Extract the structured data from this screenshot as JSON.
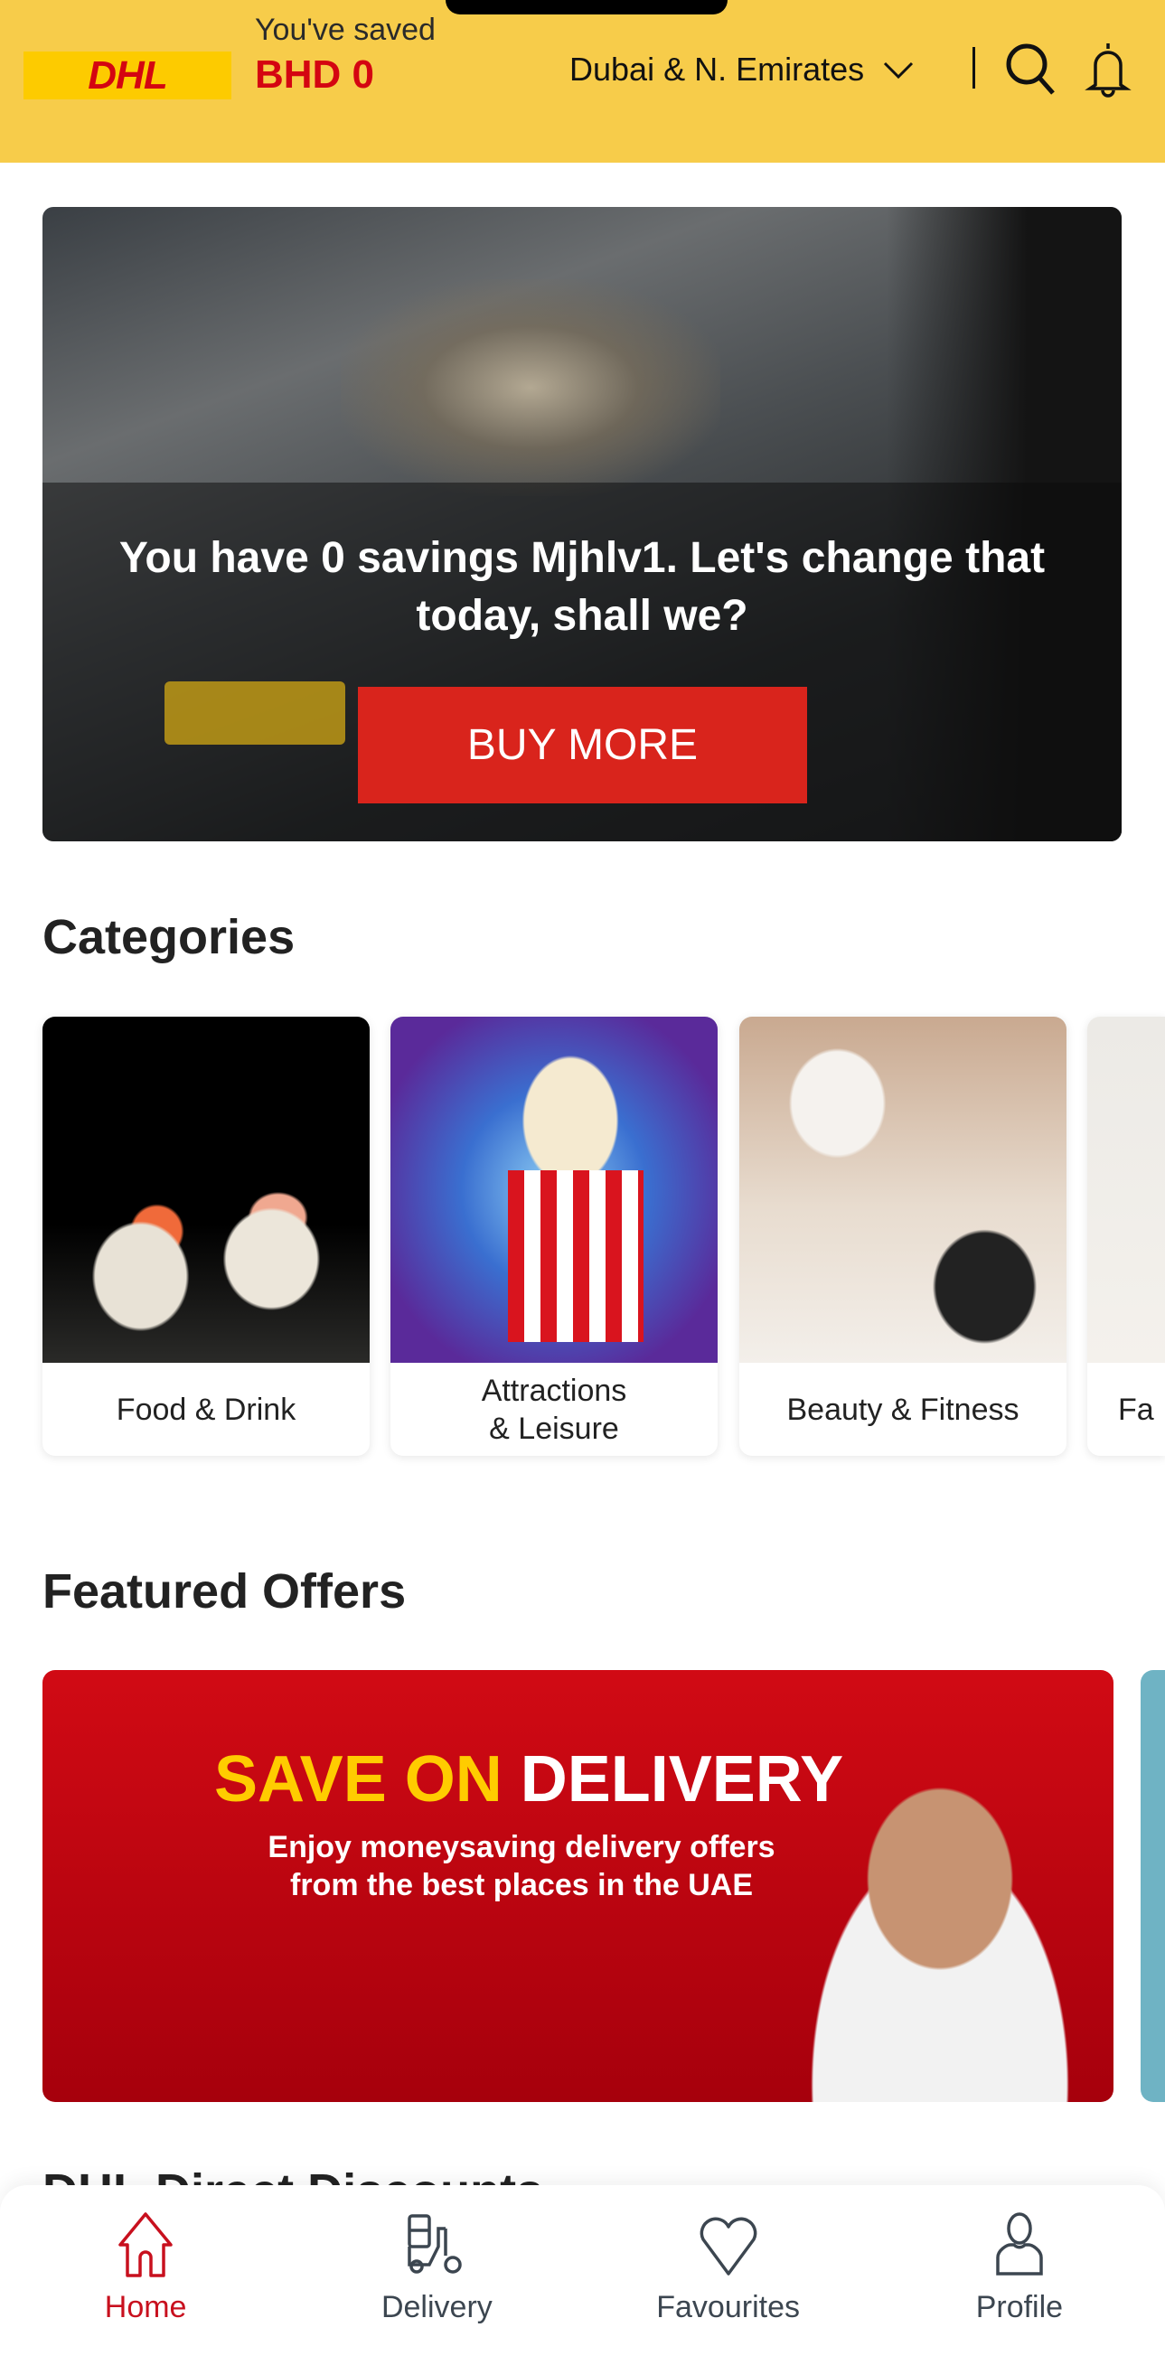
{
  "header": {
    "logo": "DHL",
    "saved_label": "You've saved",
    "saved_value": "BHD 0",
    "region": "Dubai & N. Emirates",
    "icons": [
      "chevron-down-icon",
      "search-icon",
      "bell-icon"
    ],
    "brand_color": "#f7cc4a",
    "accent": "#d40511"
  },
  "banner": {
    "message": "You have 0 savings Mjhlv1. Let's change that today, shall we?",
    "button": "BUY MORE"
  },
  "categories": {
    "title": "Categories",
    "items": [
      {
        "label": "Food & Drink"
      },
      {
        "label": "Attractions\n& Leisure"
      },
      {
        "label": "Beauty & Fitness"
      },
      {
        "label": "Fa"
      }
    ]
  },
  "featured": {
    "title": "Featured Offers",
    "offer": {
      "headline_a": "SAVE ON",
      "headline_b": "DELIVERY",
      "subtitle": "Enjoy moneysaving delivery offers from the best places in the UAE"
    }
  },
  "next_section": {
    "title": "DHL Direct Discounts"
  },
  "nav": {
    "items": [
      {
        "label": "Home",
        "icon": "home-icon",
        "active": true
      },
      {
        "label": "Delivery",
        "icon": "scooter-icon"
      },
      {
        "label": "Favourites",
        "icon": "heart-icon"
      },
      {
        "label": "Profile",
        "icon": "user-icon"
      }
    ]
  }
}
